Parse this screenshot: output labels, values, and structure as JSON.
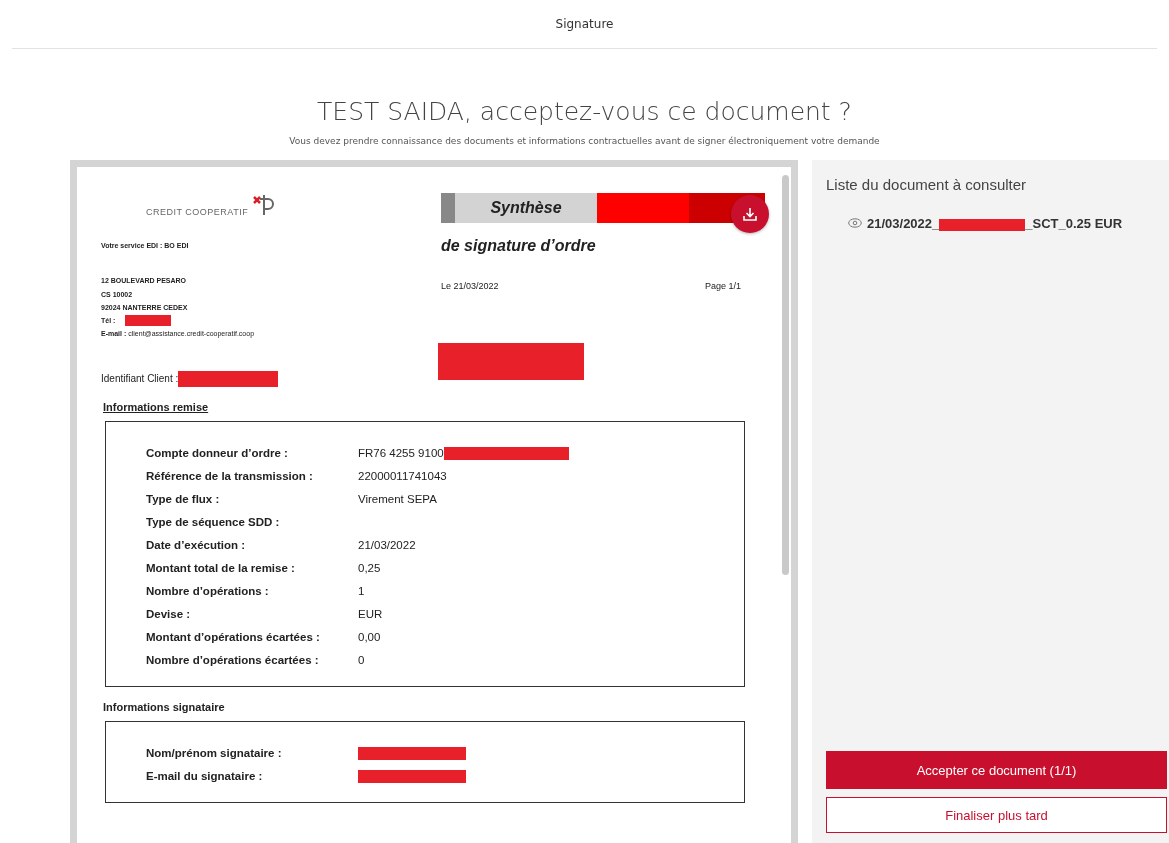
{
  "header": {
    "title": "Signature"
  },
  "heading": "TEST SAIDA, acceptez-vous ce  document ?",
  "subtitle": "Vous devez prendre connaissance des documents et informations contractuelles avant de signer électroniquement votre demande",
  "document": {
    "logo_text": "CREDIT COOPERATIF",
    "service": "Votre service EDI : BO EDI",
    "address": [
      "12 BOULEVARD PESARO",
      "CS 10002",
      "92024 NANTERRE CEDEX"
    ],
    "tel_label": "Tél :",
    "email": "**E-mail :** client@assistance.credit-cooperatif.coop",
    "band_title": "Synthèse",
    "doc_title": "de signature d’ordre",
    "date": "Le 21/03/2022",
    "page": "Page 1/1",
    "client_label": "Identifiant Client :",
    "sections": [
      {
        "title": "Informations remise",
        "rows": [
          {
            "label": "Compte donneur d’ordre :",
            "value": "FR76 4255 9100",
            "redacted": true
          },
          {
            "label": "Référence de la transmission :",
            "value": "22000011741043",
            "redacted": false
          },
          {
            "label": "Type de flux :",
            "value": "Virement SEPA",
            "redacted": false
          },
          {
            "label": "Type de séquence SDD :",
            "redacted": false
          },
          {
            "label": "Date d’exécution :",
            "value": "21/03/2022",
            "redacted": false
          },
          {
            "label": "Montant total de la remise :",
            "value": "0,25",
            "redacted": false
          },
          {
            "label": "Nombre d’opérations :",
            "value": "1",
            "redacted": false
          },
          {
            "label": "Devise :",
            "value": "EUR",
            "redacted": false
          },
          {
            "label": "Montant d’opérations écartées :",
            "value": "0,00",
            "redacted": false
          },
          {
            "label": "Nombre d’opérations écartées :",
            "value": "0",
            "redacted": false
          }
        ]
      },
      {
        "title": "Informations signataire",
        "rows": [
          {
            "label": "Nom/prénom signataire :",
            "redacted": true
          },
          {
            "label": "E-mail du signataire :",
            "redacted": true
          }
        ]
      }
    ]
  },
  "panel": {
    "title": "Liste du document à consulter",
    "documents": [
      {
        "name_start": "21/03/2022_",
        "name_end": "_SCT_0.25 EUR"
      }
    ],
    "buttons": [
      {
        "label": "Accepter ce document (1/1)",
        "kind": "primary"
      },
      {
        "label": "Finaliser plus tard",
        "kind": "secondary"
      }
    ]
  }
}
